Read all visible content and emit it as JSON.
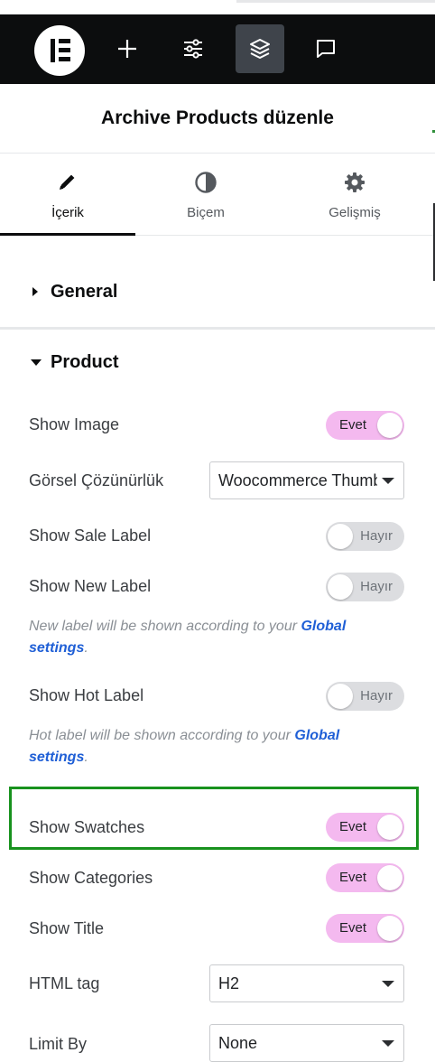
{
  "toolbar": {
    "icons": [
      "elementor-logo-icon",
      "plus-icon",
      "sliders-icon",
      "layers-icon",
      "chat-icon"
    ]
  },
  "panel": {
    "title": "Archive Products düzenle"
  },
  "tabs": [
    {
      "label": "İçerik",
      "icon": "pencil-icon"
    },
    {
      "label": "Biçem",
      "icon": "contrast-icon"
    },
    {
      "label": "Gelişmiş",
      "icon": "gear-icon"
    }
  ],
  "sections": {
    "general": {
      "title": "General"
    },
    "product": {
      "title": "Product"
    }
  },
  "controls": {
    "show_image": {
      "label": "Show Image",
      "value": "Evet"
    },
    "gorsel": {
      "label": "Görsel Çözünürlük",
      "value": "Woocommerce Thumbnail"
    },
    "show_sale": {
      "label": "Show Sale Label",
      "value": "Hayır"
    },
    "show_new": {
      "label": "Show New Label",
      "value": "Hayır"
    },
    "new_note": {
      "text": "New label will be shown according to your ",
      "link": "Global settings",
      "tail": "."
    },
    "show_hot": {
      "label": "Show Hot Label",
      "value": "Hayır"
    },
    "hot_note": {
      "text": "Hot label will be shown according to your ",
      "link": "Global settings",
      "tail": "."
    },
    "show_swatches": {
      "label": "Show Swatches",
      "value": "Evet"
    },
    "show_categories": {
      "label": "Show Categories",
      "value": "Evet"
    },
    "show_title": {
      "label": "Show Title",
      "value": "Evet"
    },
    "html_tag": {
      "label": "HTML tag",
      "value": "H2"
    },
    "limit_by": {
      "label": "Limit By",
      "value": "None"
    }
  },
  "colors": {
    "toggle_on": "#f4b9ef",
    "toggle_off": "#dcdde0",
    "highlight": "#18921e",
    "link": "#1f5fd6"
  }
}
